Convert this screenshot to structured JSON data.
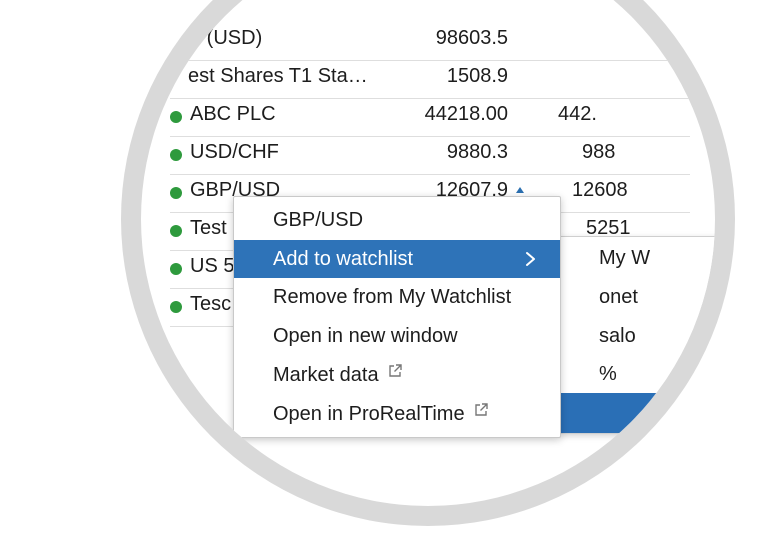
{
  "rows": [
    {
      "name": "n (USD)",
      "value1": "98603.5",
      "value2": "",
      "indicator": false
    },
    {
      "name": "est Shares T1 Sta…",
      "value1": "1508.9",
      "value2": "",
      "indicator": false
    },
    {
      "name": "ABC PLC",
      "value1": "44218.00",
      "value2": "442.",
      "indicator": true
    },
    {
      "name": "USD/CHF",
      "value1": "9880.3",
      "value2": "988",
      "indicator": true
    },
    {
      "name": "GBP/USD",
      "value1": "12607.9",
      "value2": "12608",
      "indicator": true
    },
    {
      "name": "Test",
      "value1": "",
      "value2": "5251",
      "indicator": true
    },
    {
      "name": "US 5",
      "value1": "",
      "value2": "",
      "indicator": true
    },
    {
      "name": "Tesc",
      "value1": "",
      "value2": "",
      "indicator": true
    }
  ],
  "context_menu": {
    "title": "GBP/USD",
    "items": [
      {
        "label": "Add to watchlist",
        "has_submenu": true,
        "active": true
      },
      {
        "label": "Remove from My Watchlist",
        "external": false
      },
      {
        "label": "Open in new window",
        "external": false
      },
      {
        "label": "Market data",
        "external": true
      },
      {
        "label": "Open in ProRealTime",
        "external": true
      }
    ]
  },
  "submenu": {
    "items": [
      "My W",
      "onet",
      "salo",
      "%"
    ]
  },
  "icons": {
    "submenu_arrow": "chevron-right-icon",
    "external": "external-link-icon",
    "status": "status-dot-icon",
    "price_change": "triangle-up-icon"
  },
  "colors": {
    "highlight": "#2e73b8",
    "status_green": "#2e9a3d",
    "ring": "#d9d9d9"
  }
}
